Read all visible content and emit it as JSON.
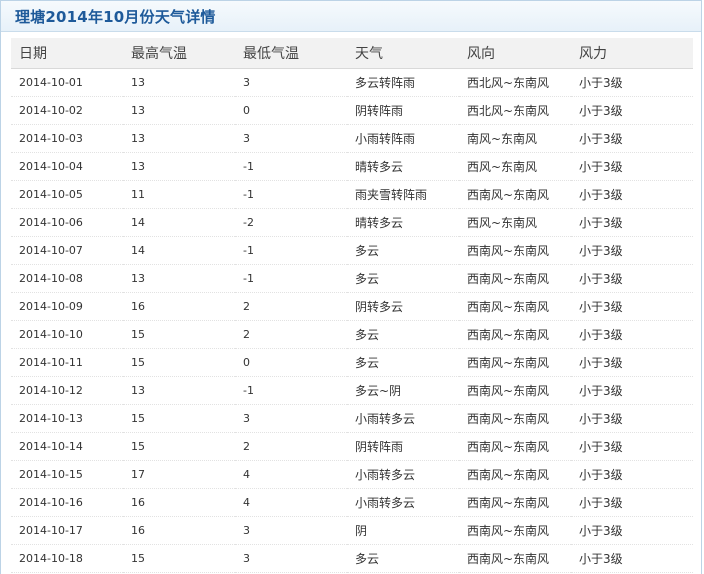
{
  "page": {
    "title": "理塘2014年10月份天气详情"
  },
  "table": {
    "headers": [
      "日期",
      "最高气温",
      "最低气温",
      "天气",
      "风向",
      "风力"
    ],
    "rows": [
      [
        "2014-10-01",
        "13",
        "3",
        "多云转阵雨",
        "西北风~东南风",
        "小于3级"
      ],
      [
        "2014-10-02",
        "13",
        "0",
        "阴转阵雨",
        "西北风~东南风",
        "小于3级"
      ],
      [
        "2014-10-03",
        "13",
        "3",
        "小雨转阵雨",
        "南风~东南风",
        "小于3级"
      ],
      [
        "2014-10-04",
        "13",
        "-1",
        "晴转多云",
        "西风~东南风",
        "小于3级"
      ],
      [
        "2014-10-05",
        "11",
        "-1",
        "雨夹雪转阵雨",
        "西南风~东南风",
        "小于3级"
      ],
      [
        "2014-10-06",
        "14",
        "-2",
        "晴转多云",
        "西风~东南风",
        "小于3级"
      ],
      [
        "2014-10-07",
        "14",
        "-1",
        "多云",
        "西南风~东南风",
        "小于3级"
      ],
      [
        "2014-10-08",
        "13",
        "-1",
        "多云",
        "西南风~东南风",
        "小于3级"
      ],
      [
        "2014-10-09",
        "16",
        "2",
        "阴转多云",
        "西南风~东南风",
        "小于3级"
      ],
      [
        "2014-10-10",
        "15",
        "2",
        "多云",
        "西南风~东南风",
        "小于3级"
      ],
      [
        "2014-10-11",
        "15",
        "0",
        "多云",
        "西南风~东南风",
        "小于3级"
      ],
      [
        "2014-10-12",
        "13",
        "-1",
        "多云~阴",
        "西南风~东南风",
        "小于3级"
      ],
      [
        "2014-10-13",
        "15",
        "3",
        "小雨转多云",
        "西南风~东南风",
        "小于3级"
      ],
      [
        "2014-10-14",
        "15",
        "2",
        "阴转阵雨",
        "西南风~东南风",
        "小于3级"
      ],
      [
        "2014-10-15",
        "17",
        "4",
        "小雨转多云",
        "西南风~东南风",
        "小于3级"
      ],
      [
        "2014-10-16",
        "16",
        "4",
        "小雨转多云",
        "西南风~东南风",
        "小于3级"
      ],
      [
        "2014-10-17",
        "16",
        "3",
        "阴",
        "西南风~东南风",
        "小于3级"
      ],
      [
        "2014-10-18",
        "15",
        "3",
        "多云",
        "西南风~东南风",
        "小于3级"
      ]
    ]
  }
}
